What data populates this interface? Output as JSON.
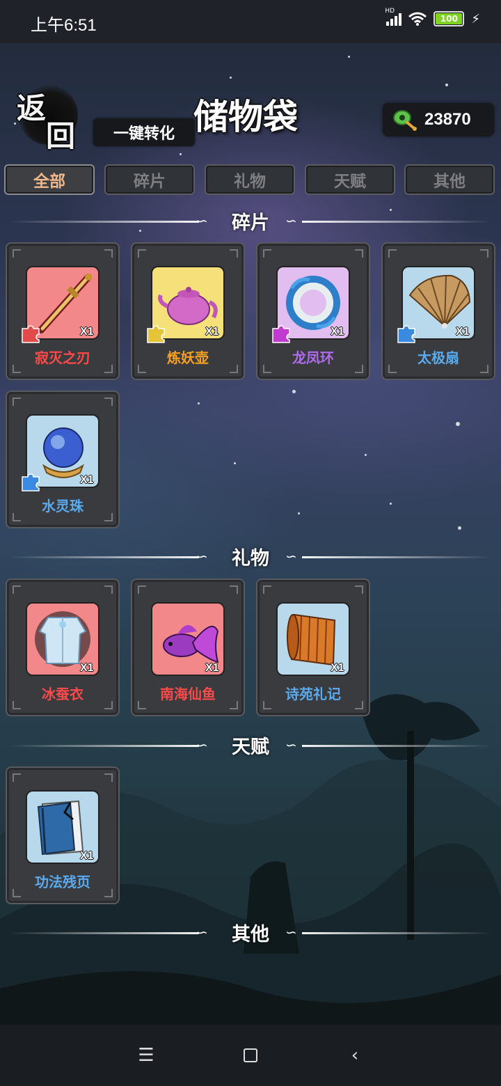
{
  "status_bar": {
    "time": "上午6:51",
    "battery": "100",
    "network_label": "HD"
  },
  "header": {
    "back_label_1": "返",
    "back_label_2": "回",
    "convert_label": "一键转化",
    "title": "储物袋",
    "currency_value": "23870"
  },
  "tabs": [
    {
      "label": "全部",
      "active": true
    },
    {
      "label": "碎片",
      "active": false
    },
    {
      "label": "礼物",
      "active": false
    },
    {
      "label": "天赋",
      "active": false
    },
    {
      "label": "其他",
      "active": false
    }
  ],
  "sections": {
    "fragments": {
      "title": "碎片",
      "items": [
        {
          "name": "寂灭之刃",
          "qty": "X1",
          "icon": "sword-icon",
          "name_color": "#ff4a4a",
          "bg_color": "#f2888a",
          "puzzle_color": "#e24b4b"
        },
        {
          "name": "炼妖壶",
          "qty": "X1",
          "icon": "teapot-icon",
          "name_color": "#f5a020",
          "bg_color": "#f6e07a",
          "puzzle_color": "#e6c43a"
        },
        {
          "name": "龙凤环",
          "qty": "X1",
          "icon": "ring-icon",
          "name_color": "#b06cf0",
          "bg_color": "#e1bdf0",
          "puzzle_color": "#c23bd0"
        },
        {
          "name": "太极扇",
          "qty": "X1",
          "icon": "fan-icon",
          "name_color": "#5aaaf0",
          "bg_color": "#b8d8ec",
          "puzzle_color": "#3a8ae0"
        },
        {
          "name": "水灵珠",
          "qty": "X1",
          "icon": "orb-icon",
          "name_color": "#5aaaf0",
          "bg_color": "#b8d8ec",
          "puzzle_color": "#3a8ae0"
        }
      ]
    },
    "gifts": {
      "title": "礼物",
      "items": [
        {
          "name": "冰蚕衣",
          "qty": "X1",
          "icon": "robe-icon",
          "name_color": "#ff4a4a",
          "bg_color": "#f2888a"
        },
        {
          "name": "南海仙鱼",
          "qty": "X1",
          "icon": "fish-icon",
          "name_color": "#ff4a4a",
          "bg_color": "#f2888a"
        },
        {
          "name": "诗苑礼记",
          "qty": "X1",
          "icon": "scroll-icon",
          "name_color": "#5aaaf0",
          "bg_color": "#b8d8ec"
        }
      ]
    },
    "talents": {
      "title": "天赋",
      "items": [
        {
          "name": "功法残页",
          "qty": "X1",
          "icon": "book-icon",
          "name_color": "#5aaaf0",
          "bg_color": "#b8d8ec"
        }
      ]
    },
    "others": {
      "title": "其他",
      "items": []
    }
  }
}
